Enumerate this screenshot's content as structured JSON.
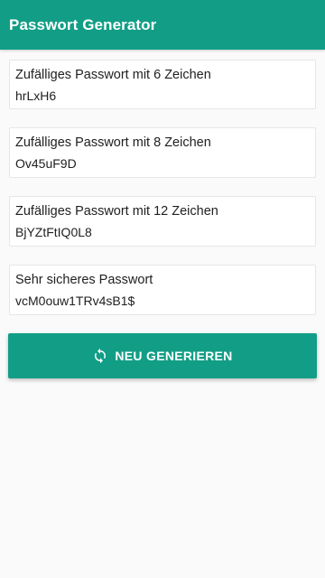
{
  "app_bar": {
    "title": "Passwort Generator",
    "color": "#129e86"
  },
  "passwords": [
    {
      "title": "Zufälliges Passwort mit 6 Zeichen",
      "value": "hrLxH6"
    },
    {
      "title": "Zufälliges Passwort mit 8 Zeichen",
      "value": "Ov45uF9D"
    },
    {
      "title": "Zufälliges Passwort mit 12 Zeichen",
      "value": "BjYZtFtIQ0L8"
    },
    {
      "title": "Sehr sicheres Passwort",
      "value": "vcM0ouw1TRv4sB1$"
    }
  ],
  "regenerate_button": {
    "label": "NEU GENERIEREN",
    "icon": "refresh-icon"
  }
}
